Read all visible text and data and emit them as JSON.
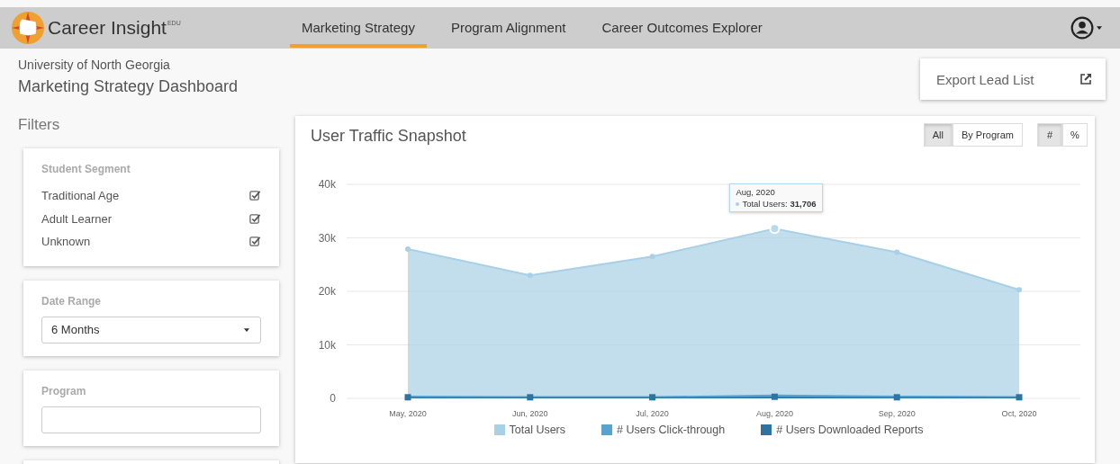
{
  "app": {
    "name": "Career Insight",
    "superscript": "EDU"
  },
  "nav_tabs": [
    {
      "label": "Marketing Strategy",
      "selected": true
    },
    {
      "label": "Program Alignment",
      "selected": false
    },
    {
      "label": "Career Outcomes Explorer",
      "selected": false
    }
  ],
  "page": {
    "institution": "University of North Georgia",
    "title": "Marketing Strategy Dashboard",
    "export_button": "Export Lead List"
  },
  "filters": {
    "heading": "Filters",
    "student_segment": {
      "label": "Student Segment",
      "options": [
        {
          "label": "Traditional Age",
          "checked": true
        },
        {
          "label": "Adult Learner",
          "checked": true
        },
        {
          "label": "Unknown",
          "checked": true
        }
      ]
    },
    "date_range": {
      "label": "Date Range",
      "value": "6 Months"
    },
    "program": {
      "label": "Program"
    }
  },
  "chart_panel": {
    "title": "User Traffic Snapshot",
    "view_toggle": [
      {
        "label": "All",
        "selected": true
      },
      {
        "label": "By Program",
        "selected": false
      }
    ],
    "unit_toggle": [
      {
        "label": "#",
        "selected": true
      },
      {
        "label": "%",
        "selected": false
      }
    ],
    "chart_data": {
      "type": "area",
      "categories": [
        "May, 2020",
        "Jun, 2020",
        "Jul, 2020",
        "Aug, 2020",
        "Sep, 2020",
        "Oct, 2020"
      ],
      "series": [
        {
          "name": "Total Users",
          "color": "#a8d0e6",
          "values": [
            27900,
            23000,
            26500,
            31706,
            27300,
            20300
          ]
        },
        {
          "name": "# Users Click-through",
          "color": "#5ba3cf",
          "values": [
            500,
            400,
            400,
            700,
            500,
            400
          ]
        },
        {
          "name": "# Users Downloaded Reports",
          "color": "#2f73a0",
          "values": [
            200,
            200,
            200,
            300,
            200,
            200
          ]
        }
      ],
      "grid": true,
      "ylim": [
        0,
        40000
      ],
      "yticks": [
        {
          "value": 0,
          "label": "0"
        },
        {
          "value": 10000,
          "label": "10k"
        },
        {
          "value": 20000,
          "label": "20k"
        },
        {
          "value": 30000,
          "label": "30k"
        },
        {
          "value": 40000,
          "label": "40k"
        }
      ]
    },
    "tooltip": {
      "category": "Aug, 2020",
      "label": "Total Users:",
      "value": "31,706"
    }
  }
}
